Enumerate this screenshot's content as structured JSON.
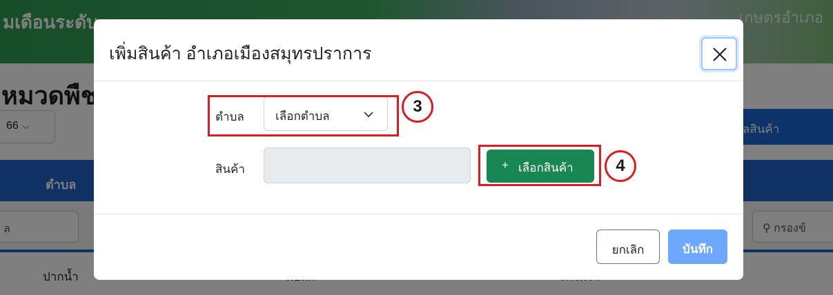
{
  "background": {
    "banner_title": "มเดือนระดับ",
    "banner_right": "เกษตรอำเภอ",
    "heading": "หมวดพืช",
    "year_select": "66",
    "table_header_district": "ตำบล",
    "filter_left": "ล",
    "search_placeholder": "กรองข้",
    "add_product_button": "ูลสินค้า",
    "row": [
      "ปากน้ำ",
      "พ่อพก",
      "กะเพรา"
    ]
  },
  "modal": {
    "title": "เพิ่มสินค้า อำเภอเมืองสมุทรปราการ",
    "district_label": "ตำบล",
    "district_select_value": "เลือกตำบล",
    "product_label": "สินค้า",
    "product_input_value": "",
    "choose_product_button": "เลือกสินค้า",
    "choose_product_plus": "+",
    "cancel_button": "ยกเลิก",
    "save_button": "บันทึก"
  },
  "annotations": {
    "step_3": "3",
    "step_4": "4",
    "color": "#e11b22"
  },
  "icons": {
    "close": "close-icon",
    "select_chevron": "chevron-down-icon",
    "search": "search-icon"
  }
}
